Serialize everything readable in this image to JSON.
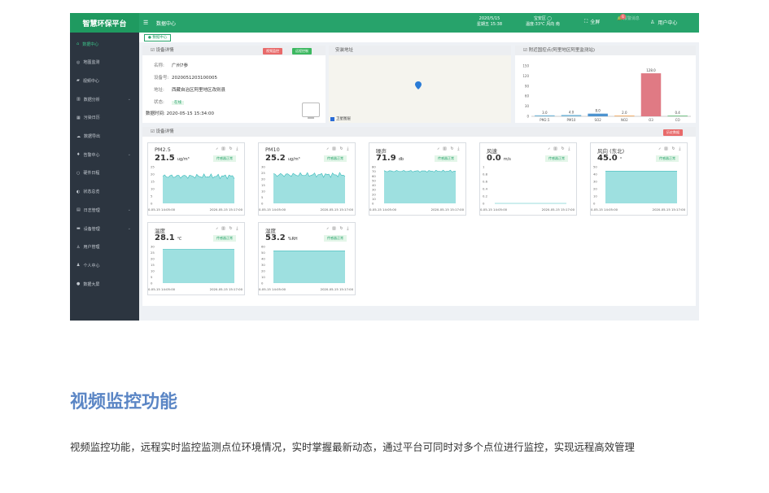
{
  "app": {
    "logo": "智慧环保平台",
    "menu_toggle_icon": "menu-icon",
    "page_title": "数据中心",
    "date_line1": "2020/5/15",
    "date_line2": "星期五 15:38",
    "weather_line1": "宝安区 ◯",
    "weather_line2": "温度:33℃ 风向 南",
    "fullscreen_label": "全屏",
    "bell_badge": "6",
    "bell_label": "报警消息",
    "user_label": "用户中心"
  },
  "sidebar": {
    "items": [
      {
        "label": "数据中心",
        "icon": "home-icon",
        "glyph": "⌂",
        "active": true,
        "has_arrow": false
      },
      {
        "label": "地图监测",
        "icon": "map-icon",
        "glyph": "◎",
        "active": false,
        "has_arrow": false
      },
      {
        "label": "视频中心",
        "icon": "video-icon",
        "glyph": "▰",
        "active": false,
        "has_arrow": false
      },
      {
        "label": "数据分析",
        "icon": "bar-chart-icon",
        "glyph": "▥",
        "active": false,
        "has_arrow": true
      },
      {
        "label": "污染日历",
        "icon": "calendar-icon",
        "glyph": "▦",
        "active": false,
        "has_arrow": false
      },
      {
        "label": "数据导出",
        "icon": "export-icon",
        "glyph": "☁",
        "active": false,
        "has_arrow": false
      },
      {
        "label": "告警中心",
        "icon": "alarm-icon",
        "glyph": "♦",
        "active": false,
        "has_arrow": true
      },
      {
        "label": "硬件日程",
        "icon": "hardware-icon",
        "glyph": "○",
        "active": false,
        "has_arrow": false
      },
      {
        "label": "状态总览",
        "icon": "status-icon",
        "glyph": "◐",
        "active": false,
        "has_arrow": false
      },
      {
        "label": "日志管理",
        "icon": "log-icon",
        "glyph": "▤",
        "active": false,
        "has_arrow": true
      },
      {
        "label": "设备管理",
        "icon": "device-icon",
        "glyph": "▬",
        "active": false,
        "has_arrow": true
      },
      {
        "label": "用户管理",
        "icon": "users-icon",
        "glyph": "♙",
        "active": false,
        "has_arrow": false
      },
      {
        "label": "个人中心",
        "icon": "person-icon",
        "glyph": "♟",
        "active": false,
        "has_arrow": false
      },
      {
        "label": "数据大屏",
        "icon": "screen-icon",
        "glyph": "●",
        "active": false,
        "has_arrow": false
      }
    ]
  },
  "tab": {
    "label": "● 数据中心"
  },
  "device_panel": {
    "title": "☑ 设备详情",
    "btn_red": "视频监控",
    "btn_green": "远程控制",
    "rows": [
      {
        "key": "名称:",
        "value": "广州7参"
      },
      {
        "key": "设备号:",
        "value": "202005120310​0005"
      },
      {
        "key": "地址:",
        "value": "西藏自治区阿里地区改则县"
      },
      {
        "key": "状态:",
        "value": "在线"
      }
    ],
    "time_key": "数据时间:",
    "time_value": "2020-05-15 15:34:00"
  },
  "map_panel": {
    "title": "安装地址",
    "satellite_label": "卫星图层"
  },
  "aqi_panel": {
    "title": "☑ 附近国控点(阿里地区阿里监测站)"
  },
  "chart_data": {
    "type": "bar",
    "categories": [
      "PM2.5",
      "PM10",
      "SO2",
      "NO2",
      "O3",
      "CO"
    ],
    "values": [
      3.0,
      4.0,
      8.0,
      2.0,
      128.0,
      0.4
    ],
    "value_labels": [
      "3.0",
      "4.0",
      "8.0",
      "2.0",
      "128.0",
      "0.4"
    ],
    "yticks": [
      "150",
      "120",
      "90",
      "60",
      "30",
      "0"
    ],
    "ylim": [
      0,
      150
    ],
    "colors": [
      "#7ab8d8",
      "#7ab8d8",
      "#4e94d0",
      "#f0a050",
      "#e07a84",
      "#59b86f"
    ]
  },
  "sensor_section": {
    "title": "☑ 设备详情",
    "btn_red": "历史数据"
  },
  "cards": [
    {
      "name": "PM2.5",
      "value": "21.5",
      "unit": "ug/m³",
      "status": "传感器正常",
      "yticks": [
        "25",
        "20",
        "15",
        "10",
        "5",
        "0"
      ],
      "x_start": "0-05-15 14:05:00",
      "x_end": "2020-05-15 15:17:00",
      "line_level": 0.74,
      "noise": 1
    },
    {
      "name": "PM10",
      "value": "25.2",
      "unit": "ug/m³",
      "status": "传感器正常",
      "yticks": [
        "30",
        "25",
        "20",
        "15",
        "10",
        "5",
        "0"
      ],
      "x_start": "0-05-15 14:05:00",
      "x_end": "2020-05-15 15:17:00",
      "line_level": 0.78,
      "noise": 1
    },
    {
      "name": "噪声",
      "value": "71.9",
      "unit": "db",
      "status": "传感器正常",
      "yticks": [
        "80",
        "70",
        "60",
        "50",
        "40",
        "30",
        "20",
        "10",
        "0"
      ],
      "x_start": "0-05-15 14:05:00",
      "x_end": "2020-05-15 15:17:00",
      "line_level": 0.88,
      "noise": 0.4
    },
    {
      "name": "风速",
      "value": "0.0",
      "unit": "m/s",
      "status": "传感器正常",
      "yticks": [
        "1",
        "0.8",
        "0.6",
        "0.4",
        "0.2",
        "0"
      ],
      "x_start": "0-05-15 14:05:00",
      "x_end": "2020-05-15 15:17:00",
      "line_level": 0.0,
      "noise": 0
    },
    {
      "name": "风向 (东北)",
      "value": "45.0",
      "unit": "°",
      "status": "传感器正常",
      "yticks": [
        "50",
        "40",
        "30",
        "20",
        "10",
        "0"
      ],
      "x_start": "0-05-15 14:05:00",
      "x_end": "2020-05-15 15:17:00",
      "line_level": 0.88,
      "noise": 0
    },
    {
      "name": "温度",
      "value": "28.1",
      "unit": "℃",
      "status": "传感器正常",
      "yticks": [
        "30",
        "25",
        "20",
        "15",
        "10",
        "5",
        "0"
      ],
      "x_start": "0-05-15 14:05:00",
      "x_end": "2020-05-15 15:17:00",
      "line_level": 0.92,
      "noise": 0
    },
    {
      "name": "湿度",
      "value": "53.2",
      "unit": "%RH",
      "status": "传感器正常",
      "yticks": [
        "60",
        "50",
        "40",
        "30",
        "20",
        "10",
        "0"
      ],
      "x_start": "0-05-15 14:05:00",
      "x_end": "2020-05-15 15:17:00",
      "line_level": 0.88,
      "noise": 0
    }
  ],
  "card_tools": "⍻ ▥ ↻ ⤓",
  "section": {
    "title": "视频监控功能",
    "desc": "视频监控功能，远程实时监控监测点位环境情况，实时掌握最新动态，通过平台可同时对多个点位进行监控，实现远程高效管理"
  }
}
